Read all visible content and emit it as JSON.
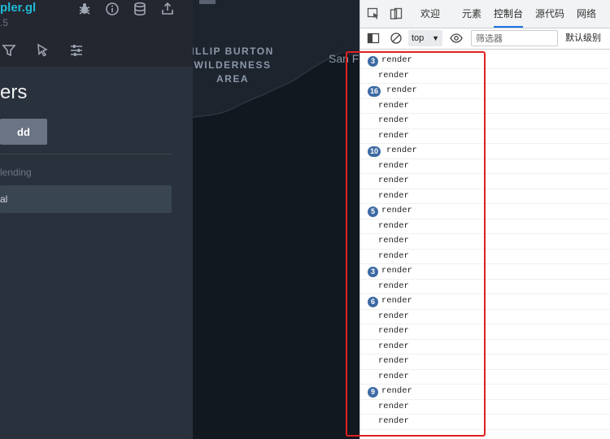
{
  "app": {
    "title": "pler.gl",
    "version": ".5"
  },
  "panel": {
    "section_title": "ers",
    "add_data_label": "dd Data",
    "blending_label": "lending",
    "blending_value": "al"
  },
  "map": {
    "wilderness_label_1": "ILLIP BURTON",
    "wilderness_label_2": "WILDERNESS",
    "wilderness_label_3": "AREA",
    "city_label": "San F"
  },
  "devtools": {
    "tabs": [
      {
        "label": "欢迎"
      },
      {
        "label": "元素"
      },
      {
        "label": "控制台"
      },
      {
        "label": "源代码"
      },
      {
        "label": "网络"
      }
    ],
    "context": "top",
    "filter_placeholder": "筛选器",
    "level_label": "默认级别",
    "logs": [
      {
        "count": "3",
        "text": "render"
      },
      {
        "count": "",
        "text": "render"
      },
      {
        "count": "16",
        "text": "render"
      },
      {
        "count": "",
        "text": "render"
      },
      {
        "count": "",
        "text": "render"
      },
      {
        "count": "",
        "text": "render"
      },
      {
        "count": "10",
        "text": "render"
      },
      {
        "count": "",
        "text": "render"
      },
      {
        "count": "",
        "text": "render"
      },
      {
        "count": "",
        "text": "render"
      },
      {
        "count": "5",
        "text": "render"
      },
      {
        "count": "",
        "text": "render"
      },
      {
        "count": "",
        "text": "render"
      },
      {
        "count": "",
        "text": "render"
      },
      {
        "count": "3",
        "text": "render"
      },
      {
        "count": "",
        "text": "render"
      },
      {
        "count": "6",
        "text": "render"
      },
      {
        "count": "",
        "text": "render"
      },
      {
        "count": "",
        "text": "render"
      },
      {
        "count": "",
        "text": "render"
      },
      {
        "count": "",
        "text": "render"
      },
      {
        "count": "",
        "text": "render"
      },
      {
        "count": "9",
        "text": "render"
      },
      {
        "count": "",
        "text": "render"
      },
      {
        "count": "",
        "text": "render"
      }
    ]
  },
  "colors": {
    "accent": "#1fbad6",
    "highlight": "#e02020",
    "badge": "#3c6aa3"
  }
}
